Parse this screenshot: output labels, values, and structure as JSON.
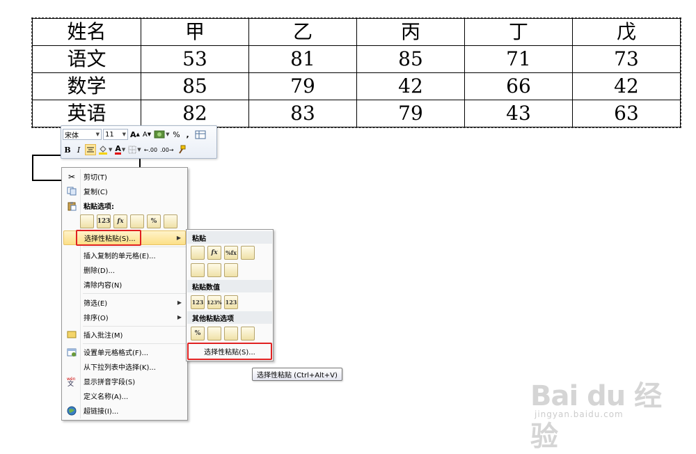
{
  "table": {
    "headers": [
      "姓名",
      "甲",
      "乙",
      "丙",
      "丁",
      "戊"
    ],
    "rows": [
      [
        "语文",
        "53",
        "81",
        "85",
        "71",
        "73"
      ],
      [
        "数学",
        "85",
        "79",
        "42",
        "66",
        "42"
      ],
      [
        "英语",
        "82",
        "83",
        "79",
        "43",
        "63"
      ]
    ]
  },
  "mini_toolbar": {
    "font_name": "宋体",
    "font_size": "11",
    "grow_font": "A",
    "shrink_font": "A",
    "percent": "%",
    "comma": ",",
    "bold": "B",
    "italic": "I",
    "font_color": "A",
    "inc_decimal": ".00",
    "dec_decimal": ".00"
  },
  "context_menu": {
    "cut": "剪切(T)",
    "copy": "复制(C)",
    "paste_options": "粘贴选项:",
    "paste_icons": [
      "",
      "123",
      "fx",
      "",
      "%",
      ""
    ],
    "paste_special": "选择性粘贴(S)...",
    "insert_copied": "插入复制的单元格(E)...",
    "delete": "删除(D)...",
    "clear": "清除内容(N)",
    "filter": "筛选(E)",
    "sort": "排序(O)",
    "insert_comment": "插入批注(M)",
    "format_cells": "设置单元格格式(F)...",
    "pick_from_list": "从下拉列表中选择(K)...",
    "phonetic": "显示拼音字段(S)",
    "define_name": "定义名称(A)...",
    "hyperlink": "超链接(I)..."
  },
  "submenu": {
    "paste_head": "粘贴",
    "paste_icons_1": [
      "",
      "fx",
      "%fx",
      ""
    ],
    "paste_icons_2": [
      "",
      "",
      ""
    ],
    "values_head": "粘贴数值",
    "values_icons": [
      "123",
      "123%",
      "123"
    ],
    "other_head": "其他粘贴选项",
    "other_icons": [
      "%",
      "",
      "",
      ""
    ],
    "paste_special": "选择性粘贴(S)..."
  },
  "tooltip": "选择性粘贴 (Ctrl+Alt+V)",
  "watermark": {
    "main": "Bai du 经验",
    "sub": "jingyan.baidu.com"
  }
}
